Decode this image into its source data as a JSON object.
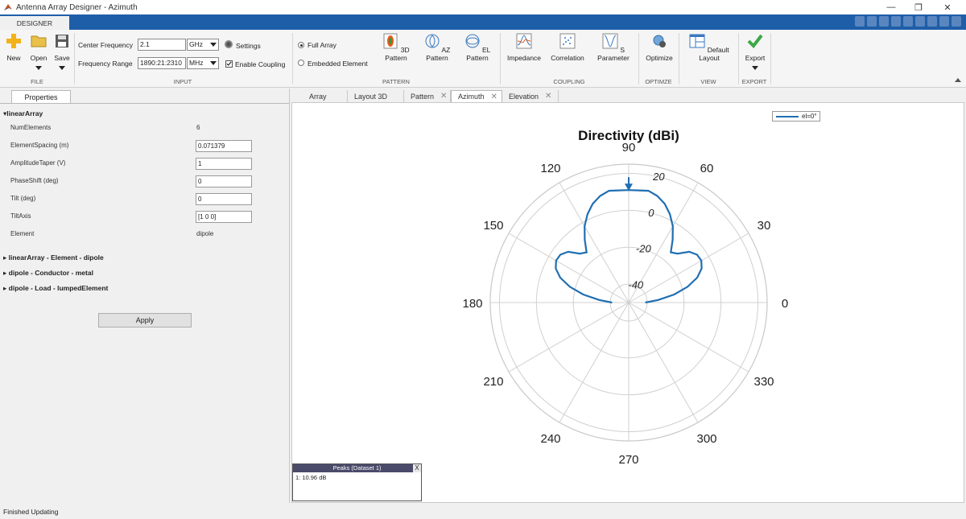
{
  "window": {
    "title": "Antenna Array Designer - Azimuth",
    "minimize": "—",
    "restore": "❐",
    "close": "✕"
  },
  "toolstrip_tab": "DESIGNER",
  "ribbon": {
    "file": {
      "section": "FILE",
      "new": "New",
      "open": "Open",
      "save": "Save"
    },
    "input": {
      "section": "INPUT",
      "center_frequency_label": "Center Frequency",
      "center_frequency_value": "2.1",
      "center_frequency_unit": "GHz",
      "settings": "Settings",
      "frequency_range_label": "Frequency Range",
      "frequency_range_value": "1890:21:2310",
      "frequency_range_unit": "MHz",
      "enable_coupling": "Enable Coupling"
    },
    "pattern": {
      "section": "PATTERN",
      "full_array": "Full Array",
      "embedded_element": "Embedded Element",
      "pattern_3d": "3D Pattern",
      "az_pattern": "AZ Pattern",
      "el_pattern": "EL Pattern"
    },
    "coupling": {
      "section": "COUPLING",
      "impedance": "Impedance",
      "correlation": "Correlation",
      "s_parameter": "S Parameter"
    },
    "optimize": {
      "section": "OPTIMZE",
      "optimize": "Optimize"
    },
    "view": {
      "section": "VIEW",
      "default_layout": "Default Layout"
    },
    "export": {
      "section": "EXPORT",
      "export": "Export"
    }
  },
  "properties": {
    "tab": "Properties",
    "group": "linearArray",
    "rows": [
      {
        "name": "NumElements",
        "value": "6"
      },
      {
        "name": "ElementSpacing (m)",
        "value": "0.071379"
      },
      {
        "name": "AmplitudeTaper (V)",
        "value": "1"
      },
      {
        "name": "PhaseShift (deg)",
        "value": "0"
      },
      {
        "name": "Tilt (deg)",
        "value": "0"
      },
      {
        "name": "TiltAxis",
        "value": "[1 0 0]"
      },
      {
        "name": "Element",
        "value": "dipole"
      }
    ],
    "collapsed": [
      "linearArray - Element - dipole",
      "dipole - Conductor - metal",
      "dipole - Load - lumpedElement"
    ],
    "apply": "Apply"
  },
  "doc_tabs": [
    "Array",
    "Layout 3D",
    "Pattern",
    "Azimuth",
    "Elevation"
  ],
  "chart_data": {
    "type": "polar",
    "title": "Directivity (dBi)",
    "angle_ticks": [
      "0",
      "30",
      "60",
      "90",
      "120",
      "150",
      "180",
      "210",
      "240",
      "270",
      "300",
      "330"
    ],
    "radial_ticks": [
      "20",
      "0",
      "-20",
      "-40"
    ],
    "rlim": [
      -50,
      25
    ],
    "legend": "el=0°",
    "series": [
      {
        "name": "el=0°",
        "color": "#1f6fb2",
        "theta_deg": [
          0,
          5,
          10,
          15,
          20,
          25,
          30,
          35,
          40,
          45,
          50,
          55,
          60,
          65,
          70,
          75,
          80,
          85,
          90,
          95,
          100,
          105,
          110,
          115,
          120,
          125,
          130,
          135,
          140,
          145,
          150,
          155,
          160,
          165,
          170,
          175,
          180
        ],
        "r_db": [
          -41,
          -34,
          -25,
          -17,
          -10.5,
          -6.4,
          -4.6,
          -4.8,
          -7.2,
          -12.5,
          -14.5,
          -8.5,
          -2.2,
          2.8,
          7,
          9.8,
          11.5,
          11,
          10.96,
          11,
          11.5,
          9.8,
          7,
          2.8,
          -2.2,
          -8.5,
          -14.5,
          -12.5,
          -7.2,
          -4.8,
          -4.6,
          -6.4,
          -10.5,
          -17,
          -25,
          -34,
          -41
        ]
      }
    ],
    "peak_marker_deg": 90
  },
  "peaks": {
    "title": "Peaks (Dataset 1)",
    "close": "X",
    "entry": "1: 10.96 dB"
  },
  "status": "Finished Updating"
}
